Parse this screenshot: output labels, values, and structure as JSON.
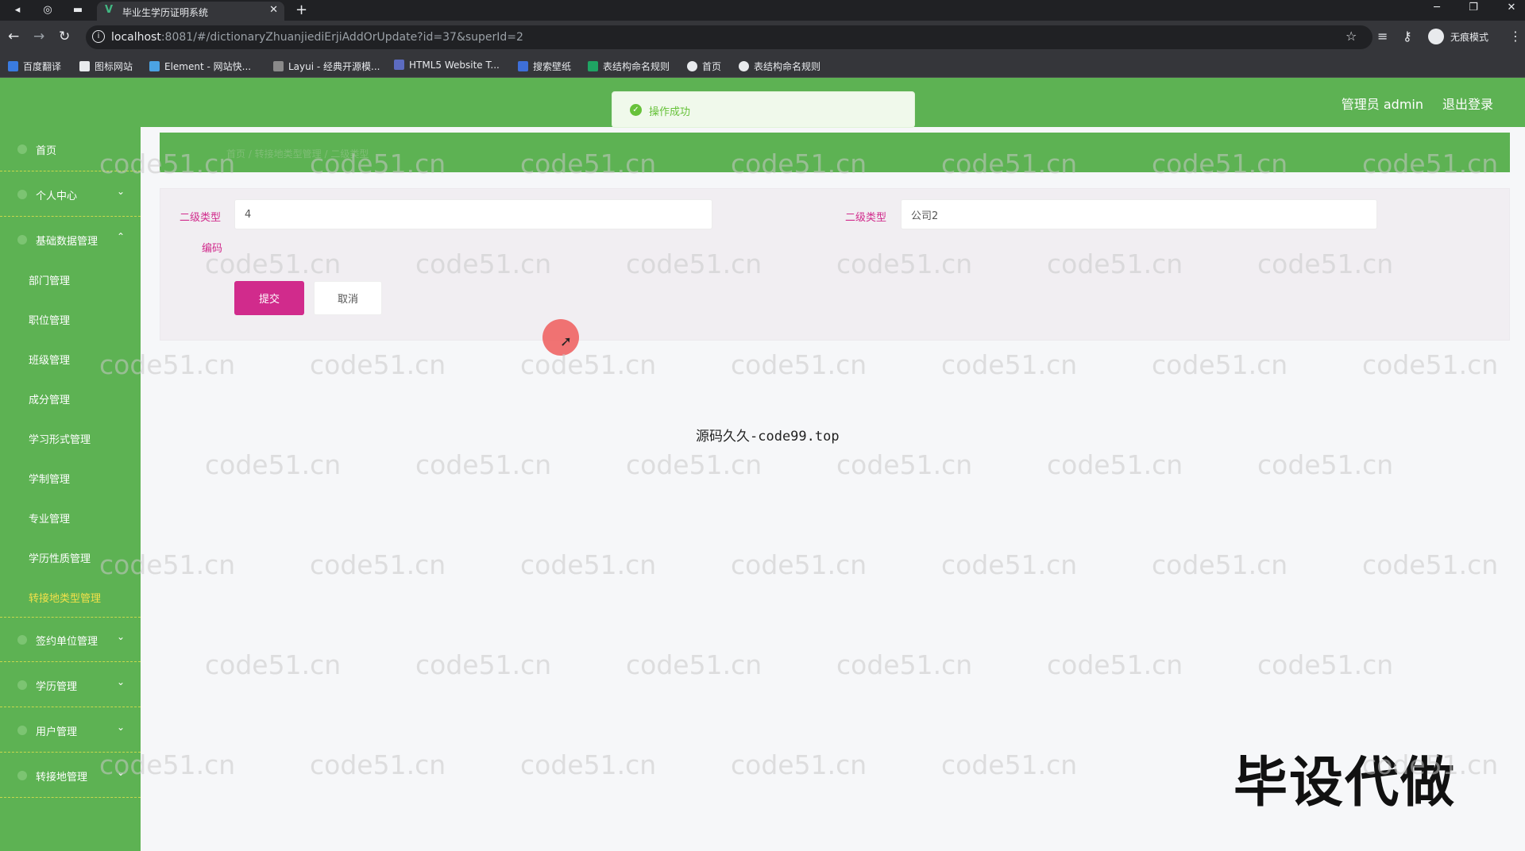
{
  "browser": {
    "tab_title": "毕业生学历证明系统",
    "url_host": "localhost",
    "url_rest": ":8081/#/dictionaryZhuanjiediErjiAddOrUpdate?id=37&superId=2",
    "incognito_label": "无痕模式",
    "bookmarks": [
      "百度翻译",
      "图标网站",
      "Element - 网站快...",
      "Layui - 经典开源模...",
      "HTML5 Website T...",
      "搜索壁纸",
      "表结构命名规则",
      "首页",
      "表结构命名规则"
    ]
  },
  "header": {
    "admin_label": "管理员 admin",
    "logout_label": "退出登录"
  },
  "toast": {
    "message": "操作成功",
    "color": "#67c23a"
  },
  "sidebar": {
    "home": "首页",
    "personal": "个人中心",
    "basic_data": "基础数据管理",
    "sub_items": [
      "部门管理",
      "职位管理",
      "班级管理",
      "成分管理",
      "学习形式管理",
      "学制管理",
      "专业管理",
      "学历性质管理",
      "转接地类型管理"
    ],
    "active_sub": "转接地类型管理",
    "signing_unit": "签约单位管理",
    "education": "学历管理",
    "users": "用户管理",
    "transfer": "转接地管理"
  },
  "breadcrumb": {
    "text": "首页 / 转接地类型管理 / 二级类型"
  },
  "form": {
    "label_left": "二级类型",
    "value_left": "4",
    "label_right": "二级类型",
    "value_right": "公司2",
    "label_code": "编码",
    "submit_label": "提交",
    "cancel_label": "取消"
  },
  "overlay": {
    "source_note": "源码久久-code99.top",
    "promo": "毕设代做",
    "watermark": "code51.cn"
  },
  "colors": {
    "theme_green": "#5db253",
    "accent_pink": "#d12b8c",
    "active_menu": "#f2e14a"
  }
}
